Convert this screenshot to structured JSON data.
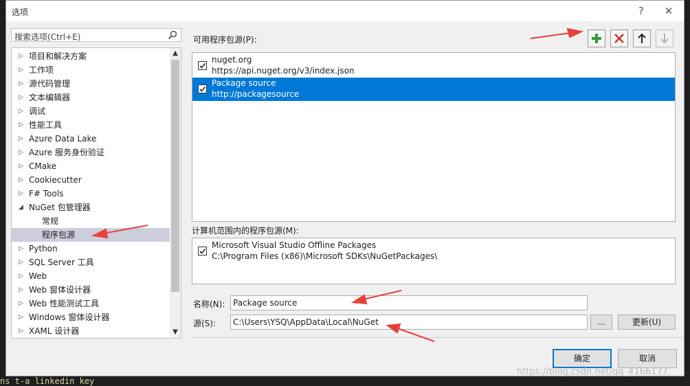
{
  "window": {
    "title": "选项",
    "help_label": "?",
    "close_label": "✕"
  },
  "search": {
    "placeholder": "搜索选项(Ctrl+E)"
  },
  "tree": {
    "items": [
      {
        "label": "项目和解决方案",
        "level": 0,
        "expanded": false,
        "selected": false
      },
      {
        "label": "工作项",
        "level": 0,
        "expanded": false,
        "selected": false
      },
      {
        "label": "源代码管理",
        "level": 0,
        "expanded": false,
        "selected": false
      },
      {
        "label": "文本编辑器",
        "level": 0,
        "expanded": false,
        "selected": false
      },
      {
        "label": "调试",
        "level": 0,
        "expanded": false,
        "selected": false
      },
      {
        "label": "性能工具",
        "level": 0,
        "expanded": false,
        "selected": false
      },
      {
        "label": "Azure Data Lake",
        "level": 0,
        "expanded": false,
        "selected": false
      },
      {
        "label": "Azure 服务身份验证",
        "level": 0,
        "expanded": false,
        "selected": false
      },
      {
        "label": "CMake",
        "level": 0,
        "expanded": false,
        "selected": false
      },
      {
        "label": "Cookiecutter",
        "level": 0,
        "expanded": false,
        "selected": false
      },
      {
        "label": "F# Tools",
        "level": 0,
        "expanded": false,
        "selected": false
      },
      {
        "label": "NuGet 包管理器",
        "level": 0,
        "expanded": true,
        "selected": false
      },
      {
        "label": "常规",
        "level": 1,
        "expanded": false,
        "selected": false
      },
      {
        "label": "程序包源",
        "level": 1,
        "expanded": false,
        "selected": true
      },
      {
        "label": "Python",
        "level": 0,
        "expanded": false,
        "selected": false
      },
      {
        "label": "SQL Server 工具",
        "level": 0,
        "expanded": false,
        "selected": false
      },
      {
        "label": "Web",
        "level": 0,
        "expanded": false,
        "selected": false
      },
      {
        "label": "Web 窗体设计器",
        "level": 0,
        "expanded": false,
        "selected": false
      },
      {
        "label": "Web 性能测试工具",
        "level": 0,
        "expanded": false,
        "selected": false
      },
      {
        "label": "Windows 窗体设计器",
        "level": 0,
        "expanded": false,
        "selected": false
      },
      {
        "label": "XAML 设计器",
        "level": 0,
        "expanded": false,
        "selected": false
      }
    ]
  },
  "sources": {
    "available_label": "可用程序包源(P):",
    "available": [
      {
        "name": "nuget.org",
        "url": "https://api.nuget.org/v3/index.json",
        "checked": true,
        "selected": false
      },
      {
        "name": "Package source",
        "url": "http://packagesource",
        "checked": true,
        "selected": true
      }
    ],
    "machine_label": "计算机范围内的程序包源(M):",
    "machine": [
      {
        "name": "Microsoft Visual Studio Offline Packages",
        "url": "C:\\Program Files (x86)\\Microsoft SDKs\\NuGetPackages\\",
        "checked": true,
        "selected": false
      }
    ]
  },
  "toolbar": {
    "add_icon": "plus-icon",
    "remove_icon": "x-icon",
    "up_icon": "arrow-up-icon",
    "down_icon": "arrow-down-icon",
    "add_color": "#2e9e2e",
    "remove_color": "#c0392b"
  },
  "form": {
    "name_label": "名称(N):",
    "name_value": "Package source",
    "source_label": "源(S):",
    "source_value": "C:\\Users\\YSQ\\AppData\\Local\\NuGet",
    "browse_label": "...",
    "update_label": "更新(U)"
  },
  "buttons": {
    "ok_label": "确定",
    "cancel_label": "取消"
  },
  "background": {
    "watermark": "https://blog.csdn.net/qq_4166177",
    "code_snippet": "ns t-a linkedin key"
  },
  "colors": {
    "selection": "#0078d7",
    "tree_selection": "#cccedb",
    "annotation_arrow": "#e8403a"
  }
}
